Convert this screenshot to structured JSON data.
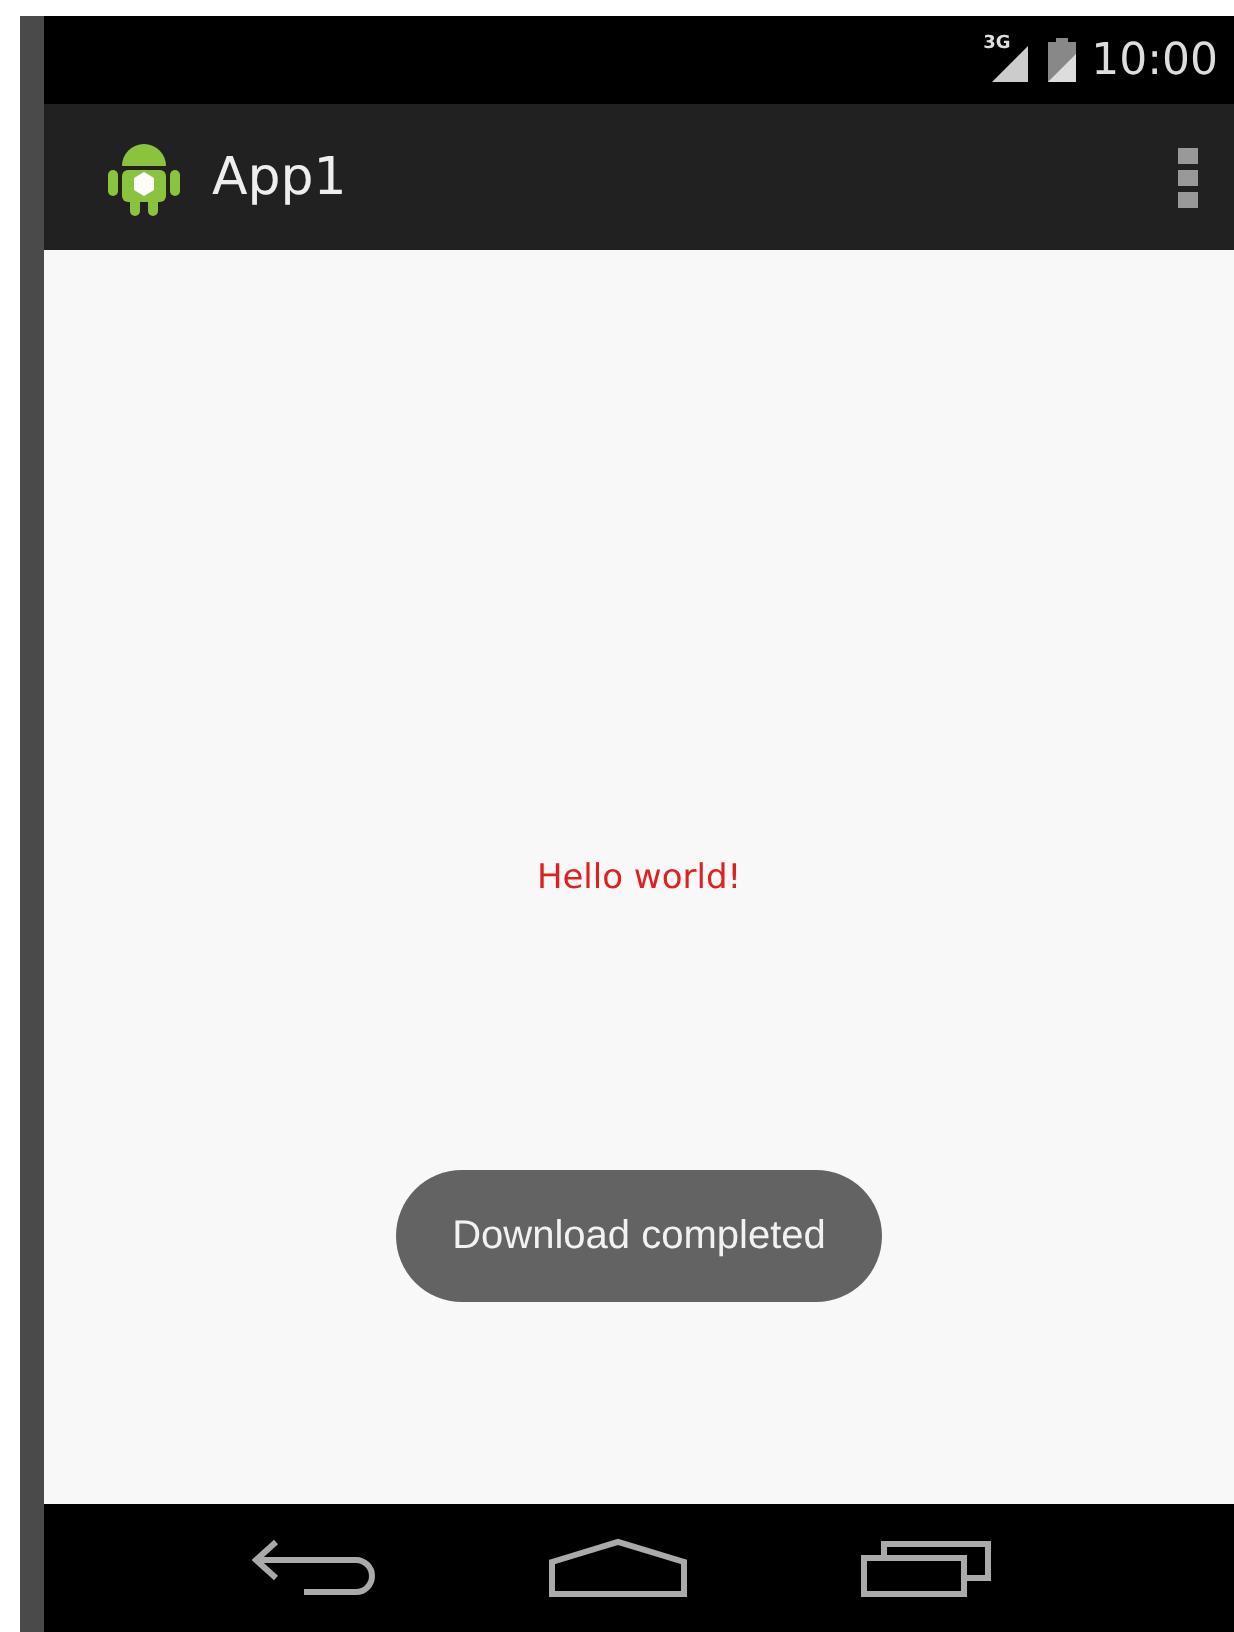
{
  "status_bar": {
    "network": "3G",
    "time": "10:00"
  },
  "action_bar": {
    "title": "App1"
  },
  "content": {
    "message": "Hello world!"
  },
  "toast": {
    "text": "Download completed"
  }
}
